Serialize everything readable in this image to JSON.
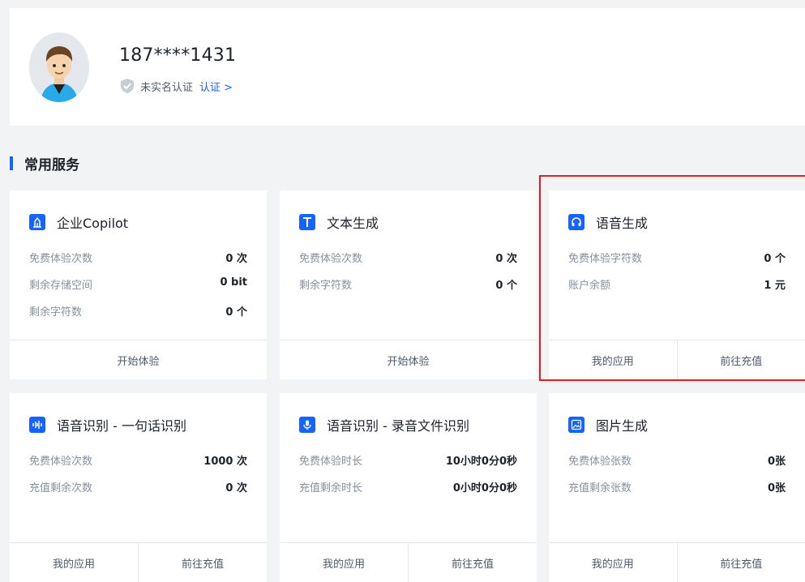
{
  "profile": {
    "phone": "187****1431",
    "verify_status": "未实名认证",
    "verify_link": "认证 >"
  },
  "section": {
    "title": "常用服务"
  },
  "cards": [
    {
      "title": "企业Copilot",
      "icon": "building-icon",
      "rows": [
        {
          "label": "免费体验次数",
          "value": "0 次"
        },
        {
          "label": "剩余存储空间",
          "value": "0 bit"
        },
        {
          "label": "剩余字符数",
          "value": "0 个"
        }
      ],
      "actions": [
        "开始体验"
      ]
    },
    {
      "title": "文本生成",
      "icon": "text-t-icon",
      "rows": [
        {
          "label": "免费体验次数",
          "value": "0 次"
        },
        {
          "label": "剩余字符数",
          "value": "0 个"
        }
      ],
      "actions": [
        "开始体验"
      ]
    },
    {
      "title": "语音生成",
      "icon": "headset-icon",
      "rows": [
        {
          "label": "免费体验字符数",
          "value": "0 个"
        },
        {
          "label": "账户余额",
          "value": "1 元"
        }
      ],
      "actions": [
        "我的应用",
        "前往充值"
      ]
    },
    {
      "title": "语音识别 - 一句话识别",
      "icon": "waveform-icon",
      "rows": [
        {
          "label": "免费体验次数",
          "value": "1000 次"
        },
        {
          "label": "充值剩余次数",
          "value": "0 次"
        }
      ],
      "actions": [
        "我的应用",
        "前往充值"
      ]
    },
    {
      "title": "语音识别 - 录音文件识别",
      "icon": "microphone-icon",
      "rows": [
        {
          "label": "免费体验时长",
          "value": "10小时0分0秒"
        },
        {
          "label": "充值剩余时长",
          "value": "0小时0分0秒"
        }
      ],
      "actions": [
        "我的应用",
        "前往充值"
      ]
    },
    {
      "title": "图片生成",
      "icon": "image-icon",
      "rows": [
        {
          "label": "免费体验张数",
          "value": "0张"
        },
        {
          "label": "充值剩余张数",
          "value": "0张"
        }
      ],
      "actions": [
        "我的应用",
        "前往充值"
      ]
    }
  ],
  "colors": {
    "accent": "#1664ff",
    "highlight": "#e02020",
    "background": "#f2f3f5"
  }
}
